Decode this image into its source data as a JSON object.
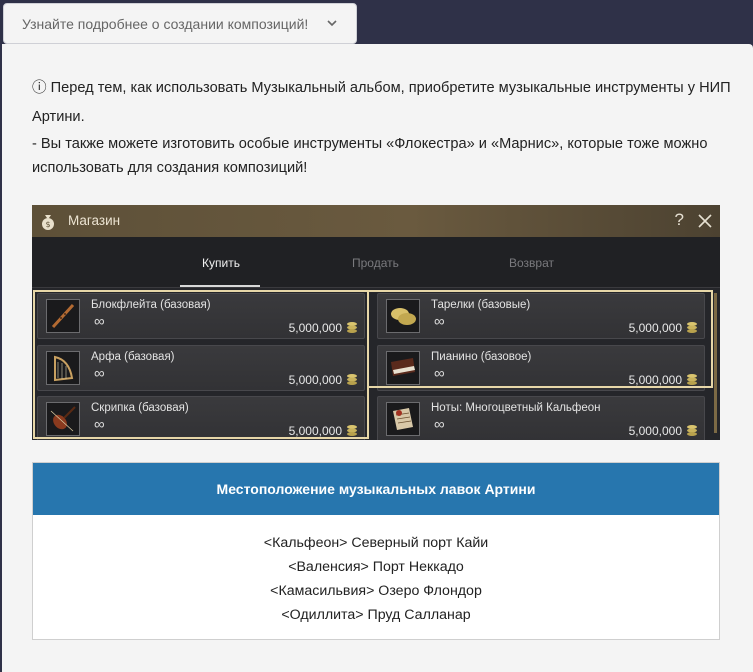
{
  "toggle": {
    "label": "Узнайте подробнее о создании композиций!"
  },
  "intro": {
    "line1": "ⓘ Перед тем, как использовать Музыкальный альбом, приобретите музыкальные инструменты у НИП Артини.",
    "line2": "- Вы также можете изготовить особые инструменты «Флокестра» и «Марнис», которые тоже можно использовать для создания композиций!"
  },
  "shop": {
    "title": "Магазин",
    "help": "?",
    "tabs": [
      "Купить",
      "Продать",
      "Возврат"
    ],
    "infinity": "∞",
    "items": [
      {
        "name": "Блокфлейта (базовая)",
        "price": "5,000,000",
        "icon": "flute-icon"
      },
      {
        "name": "Тарелки (базовые)",
        "price": "5,000,000",
        "icon": "cymbals-icon"
      },
      {
        "name": "Арфа (базовая)",
        "price": "5,000,000",
        "icon": "harp-icon"
      },
      {
        "name": "Пианино (базовое)",
        "price": "5,000,000",
        "icon": "piano-icon"
      },
      {
        "name": "Скрипка (базовая)",
        "price": "5,000,000",
        "icon": "violin-icon"
      },
      {
        "name": "Ноты: Многоцветный Кальфеон",
        "price": "5,000,000",
        "icon": "sheet-music-icon"
      }
    ]
  },
  "locations": {
    "title": "Местоположение музыкальных лавок Артини",
    "rows": [
      "<Кальфеон> Северный порт Кайи",
      "<Валенсия> Порт Неккадо",
      "<Камасильвия> Озеро Флондор",
      "<Одиллита> Пруд Салланар"
    ]
  },
  "colors": {
    "header_blue": "#2776ae",
    "highlight": "#e7d7a8",
    "page_bg": "#2f3148"
  }
}
